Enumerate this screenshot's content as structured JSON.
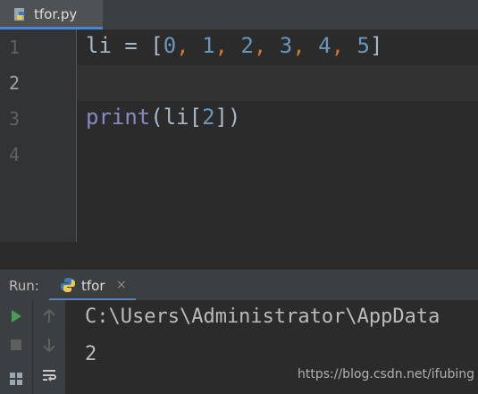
{
  "editor_tab": {
    "filename": "tfor.py",
    "icon": "python-file-icon"
  },
  "gutter": {
    "line_numbers": [
      "1",
      "2",
      "3",
      "4"
    ]
  },
  "code": {
    "line1": {
      "var": "li",
      "op": " = ",
      "open": "[",
      "items": [
        "0",
        "1",
        "2",
        "3",
        "4",
        "5"
      ],
      "close": "]"
    },
    "line3": {
      "func": "print",
      "open_paren": "(",
      "var": "li",
      "open_bracket": "[",
      "index": "2",
      "close_bracket": "]",
      "close_paren": ")"
    }
  },
  "run_panel": {
    "label": "Run:",
    "tab_name": "tfor",
    "close_glyph": "×"
  },
  "console": {
    "lines": [
      "C:\\Users\\Administrator\\AppData",
      "2"
    ]
  },
  "watermark": "https://blog.csdn.net/ifubing",
  "colors": {
    "background": "#2b2b2b",
    "keyword_number": "#6897bb",
    "comma": "#cc7832",
    "builtin": "#8888c6",
    "identifier": "#a9b7c6",
    "accent": "#4a88c7",
    "run_green": "#499c54"
  }
}
